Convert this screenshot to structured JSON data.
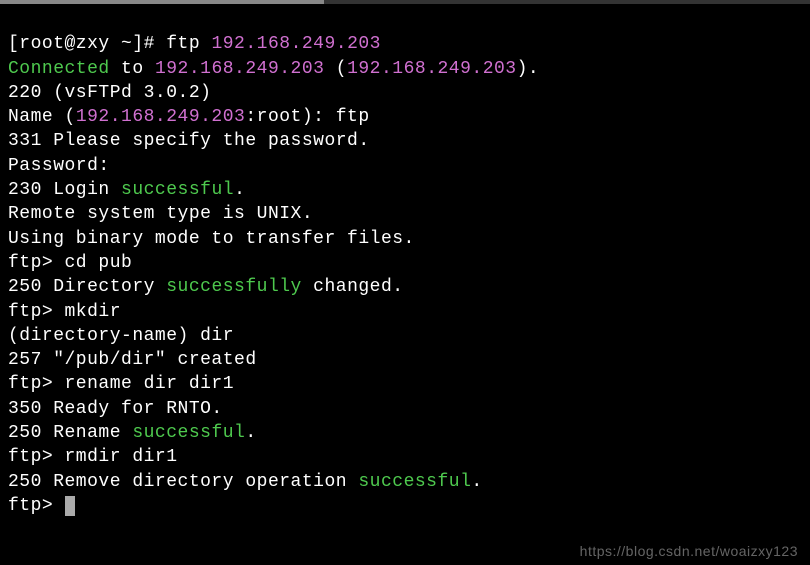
{
  "prompt": {
    "user_host": "[root@zxy ~]# ",
    "cmd": "ftp ",
    "ip": "192.168.249.203"
  },
  "lines": {
    "connected_pre": "Connected",
    "connected_mid": " to ",
    "connected_ip1": "192.168.249.203",
    "connected_paren_open": " (",
    "connected_ip2": "192.168.249.203",
    "connected_paren_close": ").",
    "l220": "220 (vsFTPd 3.0.2)",
    "name_pre": "Name (",
    "name_ip": "192.168.249.203",
    "name_post": ":root): ftp",
    "l331": "331 Please specify the password.",
    "password": "Password:",
    "l230_pre": "230 Login ",
    "l230_success": "successful",
    "l230_post": ".",
    "remote": "Remote system type is UNIX.",
    "binary": "Using binary mode to transfer files.",
    "ftp_cd": "ftp> cd pub",
    "l250a_pre": "250 Directory ",
    "l250a_success": "successfully",
    "l250a_post": " changed.",
    "ftp_mkdir": "ftp> mkdir",
    "dirname": "(directory-name) dir",
    "l257": "257 \"/pub/dir\" created",
    "ftp_rename": "ftp> rename dir dir1",
    "l350": "350 Ready for RNTO.",
    "l250b_pre": "250 Rename ",
    "l250b_success": "successful",
    "l250b_post": ".",
    "ftp_rmdir": "ftp> rmdir dir1",
    "l250c_pre": "250 Remove directory operation ",
    "l250c_success": "successful",
    "l250c_post": ".",
    "ftp_prompt": "ftp> "
  },
  "watermark": "https://blog.csdn.net/woaizxy123"
}
